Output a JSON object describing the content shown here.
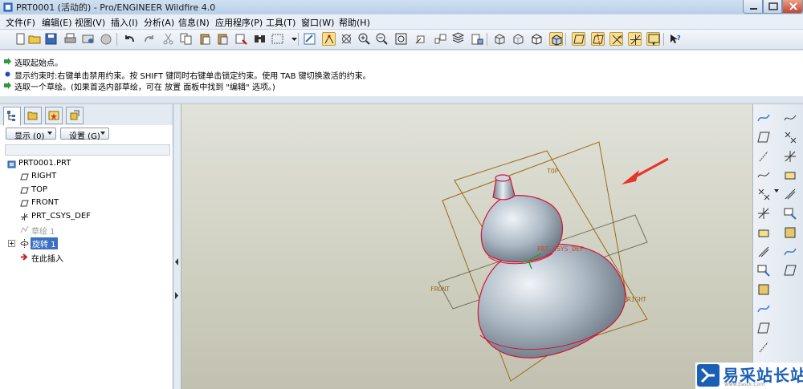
{
  "window": {
    "title": "PRT0001 (活动的) - Pro/ENGINEER Wildfire 4.0"
  },
  "menu": {
    "items": [
      "文件(F)",
      "编辑(E)",
      "视图(V)",
      "插入(I)",
      "分析(A)",
      "信息(N)",
      "应用程序(P)",
      "工具(T)",
      "窗口(W)",
      "帮助(H)"
    ]
  },
  "toolbar": {
    "icons": [
      "new-icon",
      "open-icon",
      "save-icon",
      "print-icon",
      "send-icon",
      "erase-icon",
      "undo-icon",
      "redo-icon",
      "cut-icon",
      "copy-icon",
      "paste-icon",
      "paste-special-icon",
      "regenerate-icon",
      "find-icon",
      "select-box-icon",
      "dropdown-icon",
      "sketch-icon",
      "select-sketch-icon",
      "spin-center-icon",
      "zoom-in-icon",
      "zoom-out-icon",
      "refit-icon",
      "orient-icon",
      "saved-views-icon",
      "layers-icon",
      "appearance-icon",
      "wireframe-icon",
      "hidden-line-icon",
      "no-hidden-icon",
      "shading-icon",
      "datum-planes-icon",
      "datum-axes-icon",
      "datum-points-icon",
      "csys-icon",
      "annotation-icon",
      "whats-this-icon"
    ]
  },
  "messages": [
    {
      "icon": "info-arrow-icon",
      "text": "选取起始点。"
    },
    {
      "icon": "bullet-icon",
      "text": "显示约束时:右键单击禁用约束。按 SHIFT 键同时右键单击锁定约束。使用 TAB 键切换激活的约束。"
    },
    {
      "icon": "info-arrow-icon",
      "text": "选取一个草绘。(如果首选内部草绘，可在 放置 面板中找到 \"编辑\" 选项。)"
    }
  ],
  "navigator": {
    "tabs": [
      "model-tree-icon",
      "folder-browser-icon",
      "favorites-icon",
      "connections-icon"
    ],
    "show_button": "显示 (0)",
    "settings_button": "设置 (G)",
    "tree": [
      {
        "label": "PRT0001.PRT",
        "icon": "part-icon",
        "indent": 0
      },
      {
        "label": "RIGHT",
        "icon": "datum-plane-icon",
        "indent": 1
      },
      {
        "label": "TOP",
        "icon": "datum-plane-icon",
        "indent": 1
      },
      {
        "label": "FRONT",
        "icon": "datum-plane-icon",
        "indent": 1
      },
      {
        "label": "PRT_CSYS_DEF",
        "icon": "csys-icon",
        "indent": 1
      },
      {
        "label": "草绘 1",
        "icon": "sketch-icon",
        "indent": 1
      },
      {
        "label": "旋转 1",
        "icon": "revolve-icon",
        "indent": 1,
        "selected": true
      },
      {
        "label": "在此插入",
        "icon": "insert-here-icon",
        "indent": 1
      }
    ]
  },
  "viewport": {
    "labels": {
      "top": "TOP",
      "front": "FRONT",
      "right": "RIGHT",
      "csys": "PRT_CSYS_DEF"
    },
    "background_top": "#e1e2d9",
    "background_bottom": "#c2c1b1",
    "datum_color": "#9a6a1a",
    "edge_color": "#d2143a",
    "arrow_color": "#e8342a"
  },
  "right_toolbar": {
    "icons": [
      "datum-curve-icon",
      "plane-icon",
      "axis-icon",
      "sketched-curve-icon",
      "point-icon",
      "csys-tool-icon",
      "analysis-icon",
      "ribbon-icon",
      "sketch-tool-icon",
      "insert-mode-icon",
      "extrude-icon",
      "revolve-tool-icon",
      "variable-sweep-icon",
      "blend-icon",
      "boundary-icon",
      "style-icon",
      "hole-icon",
      "round-icon",
      "chamfer-icon",
      "shell-icon",
      "draft-icon",
      "rib-icon"
    ]
  },
  "watermark": {
    "text": "易采站长站",
    "sub": "Www.Easck.Com"
  }
}
